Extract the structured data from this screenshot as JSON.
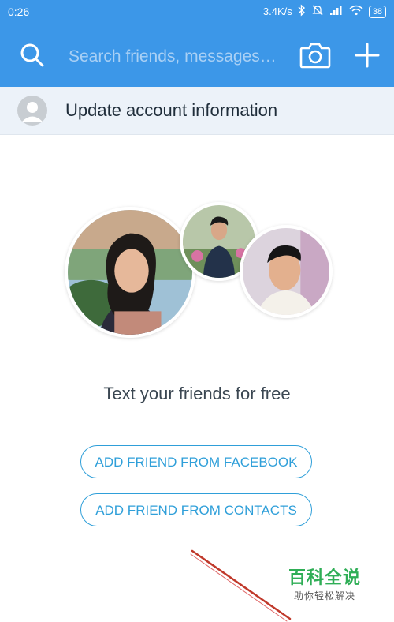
{
  "status_bar": {
    "time": "0:26",
    "network_speed": "3.4K/s",
    "battery": "38"
  },
  "header": {
    "search_placeholder": "Search friends, messages…",
    "icons": [
      "search-icon",
      "camera-icon",
      "plus-icon"
    ]
  },
  "update_row": {
    "label": "Update account information"
  },
  "main": {
    "tagline": "Text your friends for free",
    "buttons": {
      "facebook": "ADD FRIEND FROM FACEBOOK",
      "contacts": "ADD FRIEND FROM CONTACTS"
    }
  },
  "watermark": {
    "title": "百科全说",
    "subtitle": "助你轻松解决"
  },
  "colors": {
    "header_bg": "#3c97e8",
    "accent": "#2f9fd9",
    "watermark_green": "#2fae56",
    "arrow_red": "#c0392b"
  }
}
